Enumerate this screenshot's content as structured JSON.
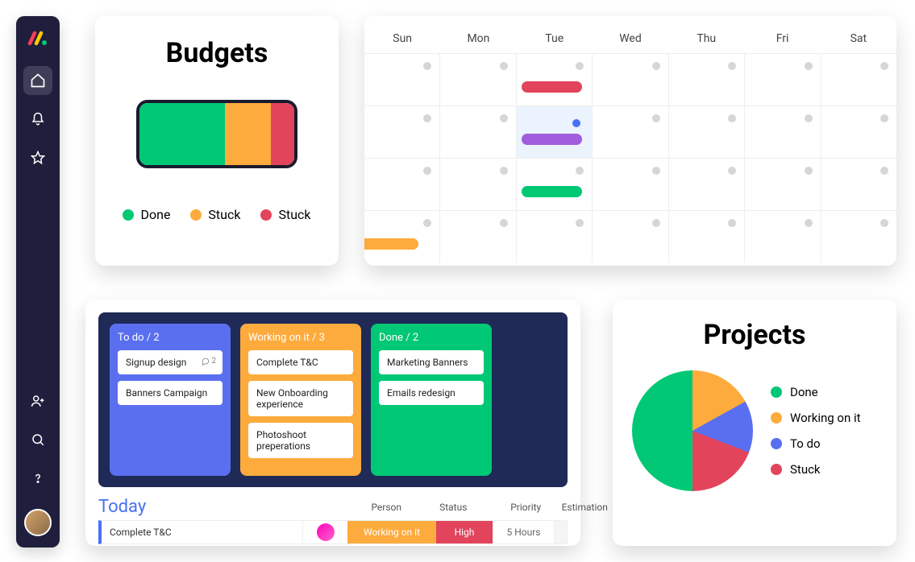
{
  "colors": {
    "done": "#00c875",
    "working": "#fdab3d",
    "stuck": "#e2445c",
    "todo_blue": "#5a6ff0",
    "link_blue": "#4970f5",
    "purple": "#a25ddc"
  },
  "budgets": {
    "title": "Budgets",
    "segments": [
      {
        "key": "done",
        "pct": 55
      },
      {
        "key": "stuck1",
        "pct": 30
      },
      {
        "key": "stuck2",
        "pct": 15
      }
    ],
    "legend": [
      {
        "label": "Done",
        "color": "#00c875"
      },
      {
        "label": "Stuck",
        "color": "#fdab3d"
      },
      {
        "label": "Stuck",
        "color": "#e2445c"
      }
    ]
  },
  "calendar": {
    "days": [
      "Sun",
      "Mon",
      "Tue",
      "Wed",
      "Thu",
      "Fri",
      "Sat"
    ]
  },
  "board": {
    "columns": [
      {
        "title": "To do / 2",
        "class": "todo",
        "tasks": [
          {
            "label": "Signup design",
            "comments": 2
          },
          {
            "label": "Banners Campaign"
          }
        ]
      },
      {
        "title": "Working on it / 3",
        "class": "working",
        "tasks": [
          {
            "label": "Complete T&C"
          },
          {
            "label": "New Onboarding experience"
          },
          {
            "label": "Photoshoot preperations"
          }
        ]
      },
      {
        "title": "Done / 2",
        "class": "done",
        "tasks": [
          {
            "label": "Marketing Banners"
          },
          {
            "label": "Emails redesign"
          }
        ]
      }
    ],
    "today": {
      "title": "Today",
      "headers": [
        "Person",
        "Status",
        "Priority",
        "Estimation"
      ],
      "row": {
        "name": "Complete T&C",
        "status": "Working on it",
        "priority": "High",
        "estimation": "5 Hours"
      }
    }
  },
  "projects": {
    "title": "Projects",
    "legend": [
      {
        "label": "Done",
        "color": "#00c875"
      },
      {
        "label": "Working on it",
        "color": "#fdab3d"
      },
      {
        "label": "To do",
        "color": "#5a6ff0"
      },
      {
        "label": "Stuck",
        "color": "#e2445c"
      }
    ]
  },
  "chart_data": [
    {
      "type": "bar",
      "title": "Budgets",
      "orientation": "stacked-horizontal",
      "categories": [
        "Budgets"
      ],
      "series": [
        {
          "name": "Done",
          "values": [
            55
          ],
          "color": "#00c875"
        },
        {
          "name": "Stuck",
          "values": [
            30
          ],
          "color": "#fdab3d"
        },
        {
          "name": "Stuck",
          "values": [
            15
          ],
          "color": "#e2445c"
        }
      ],
      "xlabel": "",
      "ylabel": "",
      "xlim": [
        0,
        100
      ]
    },
    {
      "type": "pie",
      "title": "Projects",
      "series": [
        {
          "name": "Done",
          "value": 50,
          "color": "#00c875"
        },
        {
          "name": "Working on it",
          "value": 17,
          "color": "#fdab3d"
        },
        {
          "name": "To do",
          "value": 14,
          "color": "#5a6ff0"
        },
        {
          "name": "Stuck",
          "value": 19,
          "color": "#e2445c"
        }
      ]
    }
  ]
}
